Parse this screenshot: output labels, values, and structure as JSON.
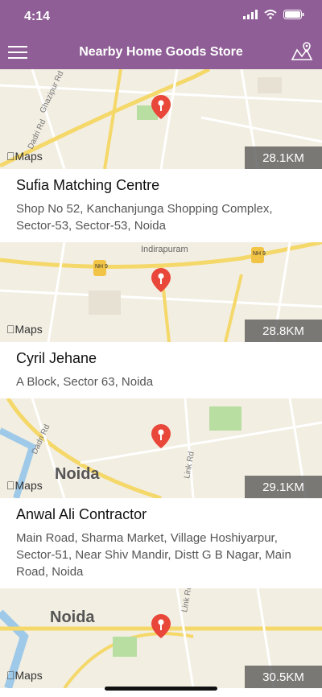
{
  "status": {
    "time": "4:14"
  },
  "header": {
    "title": "Nearby Home Goods Store"
  },
  "stores": [
    {
      "name": "Sufia Matching Centre",
      "address": "Shop No 52, Kanchanjunga Shopping Complex, Sector-53, Sector-53, Noida",
      "distance": "28.1KM",
      "map_label": "Maps"
    },
    {
      "name": "Cyril Jehane",
      "address": "A Block, Sector 63, Noida",
      "distance": "28.8KM",
      "map_label": "Maps"
    },
    {
      "name": "Anwal Ali Contractor",
      "address": "Main Road, Sharma Market, Village Hoshiyarpur, Sector-51, Near Shiv Mandir, Distt G B Nagar, Main Road, Noida",
      "distance": "29.1KM",
      "map_label": "Maps"
    },
    {
      "name": "",
      "address": "",
      "distance": "30.5KM",
      "map_label": "Maps"
    }
  ],
  "map_text": {
    "card1": [
      "Ghazipur Rd",
      "Dadri Rd"
    ],
    "card2": [
      "Indirapuram",
      "NH 9",
      "NH 9"
    ],
    "card3": [
      "Dadri Rd",
      "Noida",
      "Link Rd"
    ],
    "card4": [
      "Noida",
      "Link Rd"
    ]
  },
  "colors": {
    "header": "#8f5e96",
    "pin": "#e8473a",
    "road": "#f5d86a"
  }
}
